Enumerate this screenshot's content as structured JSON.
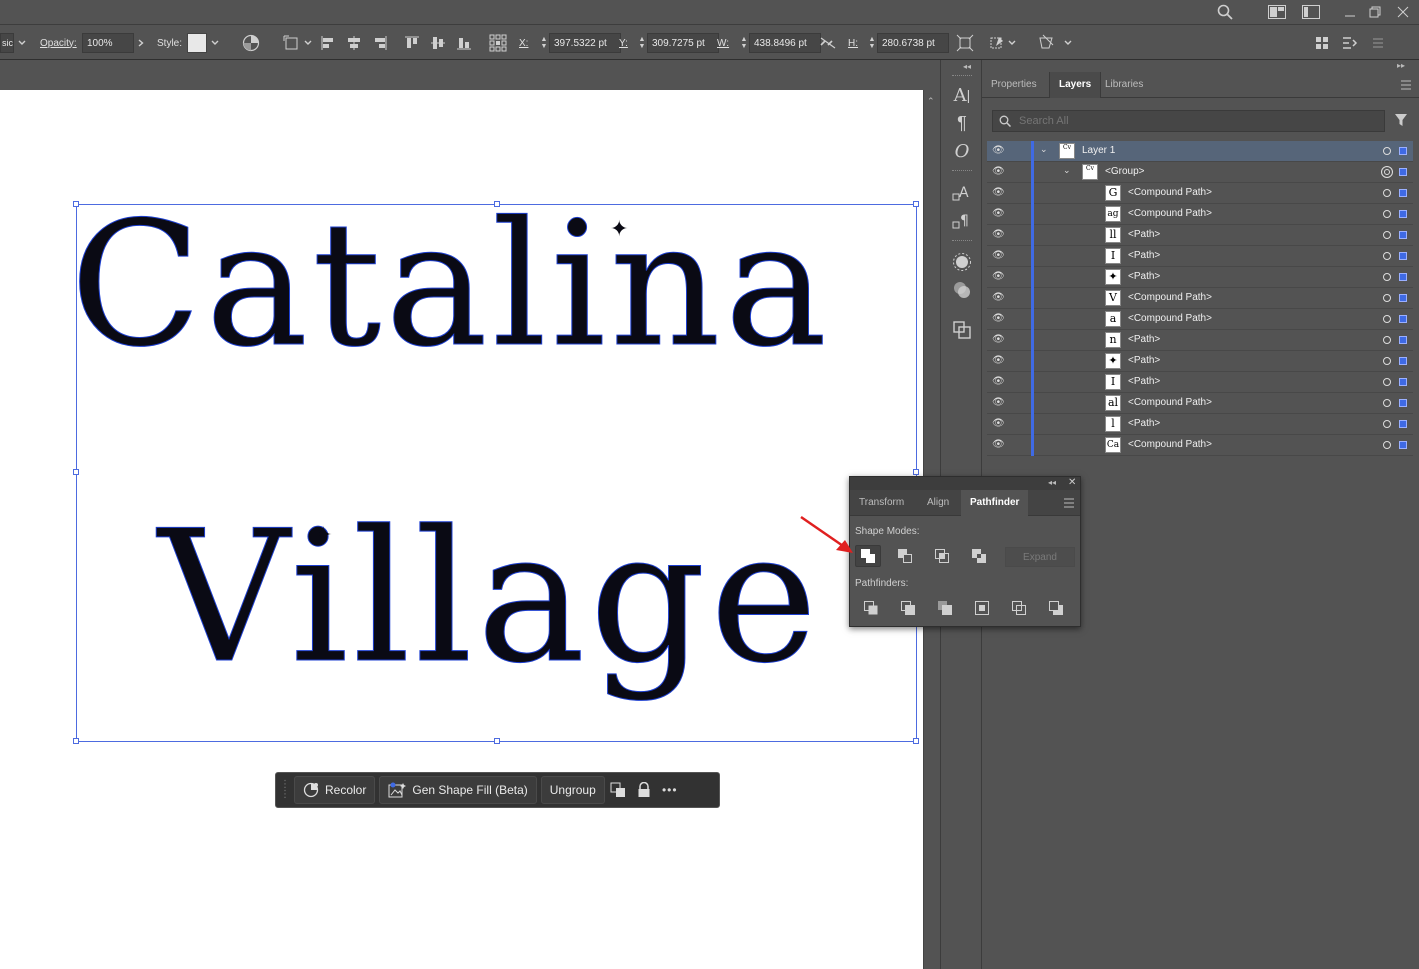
{
  "control_bar": {
    "style_mode": "sic",
    "opacity_label": "Opacity:",
    "opacity_value": "100%",
    "style_label": "Style:",
    "x_label": "X:",
    "x_value": "397.5322 pt",
    "y_label": "Y:",
    "y_value": "309.7275 pt",
    "w_label": "W:",
    "w_value": "438.8496 pt",
    "h_label": "H:",
    "h_value": "280.6738 pt"
  },
  "artwork": {
    "line1": "Catalina",
    "line2": "Village"
  },
  "taskbar": {
    "recolor": "Recolor",
    "gen_shape_fill": "Gen Shape Fill (Beta)",
    "ungroup": "Ungroup",
    "more": "•••"
  },
  "layers_panel": {
    "tabs": [
      "Properties",
      "Layers",
      "Libraries"
    ],
    "search_placeholder": "Search All",
    "rows": [
      {
        "name": "Layer 1",
        "thumb": "Cv"
      },
      {
        "name": "<Group>",
        "thumb": "Cv"
      },
      {
        "name": "<Compound Path>",
        "thumb": "G"
      },
      {
        "name": "<Compound Path>",
        "thumb": "ag"
      },
      {
        "name": "<Path>",
        "thumb": "ll"
      },
      {
        "name": "<Path>",
        "thumb": "I"
      },
      {
        "name": "<Path>",
        "thumb": "✦"
      },
      {
        "name": "<Compound Path>",
        "thumb": "V"
      },
      {
        "name": "<Compound Path>",
        "thumb": "a"
      },
      {
        "name": "<Path>",
        "thumb": "n"
      },
      {
        "name": "<Path>",
        "thumb": "✦"
      },
      {
        "name": "<Path>",
        "thumb": "I"
      },
      {
        "name": "<Compound Path>",
        "thumb": "al"
      },
      {
        "name": "<Path>",
        "thumb": "l"
      },
      {
        "name": "<Compound Path>",
        "thumb": "Ca"
      }
    ]
  },
  "pathfinder": {
    "tabs": [
      "Transform",
      "Align",
      "Pathfinder"
    ],
    "shape_modes_label": "Shape Modes:",
    "pathfinders_label": "Pathfinders:",
    "expand_label": "Expand"
  },
  "colors": {
    "accent": "#3f6ae4",
    "selection": "#4d6be0",
    "annotation_arrow": "#e02020"
  }
}
